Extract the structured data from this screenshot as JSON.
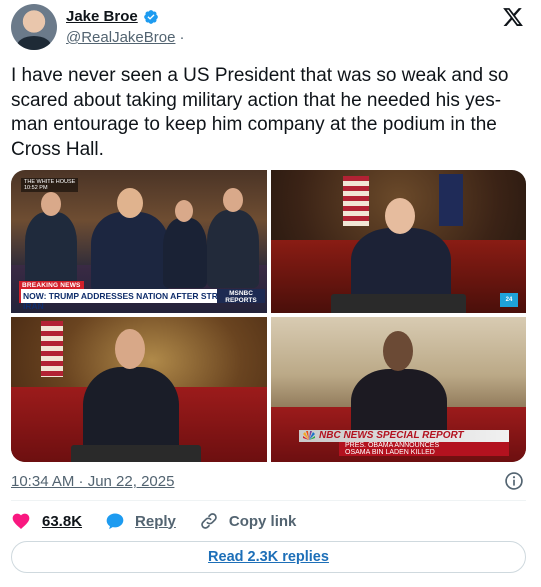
{
  "author": {
    "name": "Jake Broe",
    "handle": "@RealJakeBroe",
    "handle_separator": "·"
  },
  "tweet": {
    "text": "I have never seen a US President that was so weak and so scared about taking military action that he needed his yes-man entourage to keep him company at the podium in the Cross Hall."
  },
  "media": {
    "image1": {
      "corner_tag": "THE WHITE HOUSE\n10:52 PM",
      "breaking_label": "BREAKING NEWS",
      "ticker": "NOW: TRUMP ADDRESSES NATION AFTER STRIKES ON IRAN",
      "network": "MSNBC\nREPORTS"
    },
    "image2": {
      "badge": "24"
    },
    "image4": {
      "title": "NBC NEWS SPECIAL REPORT",
      "subtitle": "PRES. OBAMA ANNOUNCES\nOSAMA BIN LADEN KILLED"
    }
  },
  "meta": {
    "timestamp": "10:34 AM · Jun 22, 2025"
  },
  "actions": {
    "likes": "63.8K",
    "reply": "Reply",
    "copy_link": "Copy link"
  },
  "read_replies": "Read 2.3K replies",
  "colors": {
    "accent": "#1d9bf0",
    "like": "#f91880",
    "secondary_text": "#536471"
  }
}
